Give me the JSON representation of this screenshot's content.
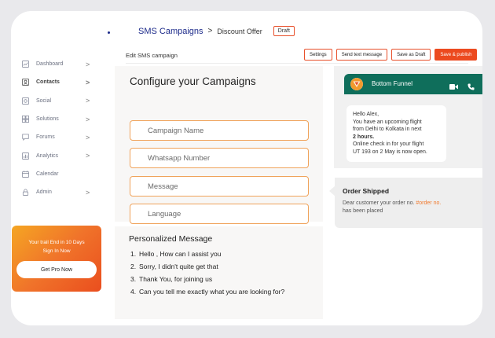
{
  "header": {
    "breadcrumb_main": "SMS Campaigns",
    "breadcrumb_sep": ">",
    "breadcrumb_sub": "Discount Offer",
    "status_badge": "Draft"
  },
  "toolbar": {
    "title": "Edit SMS campaign",
    "settings": "Settings",
    "send_test": "Send text message",
    "save_draft": "Save as Draft",
    "save_publish": "Save & publish"
  },
  "sidebar": {
    "items": [
      {
        "label": "Dashboard",
        "icon": "chart-icon"
      },
      {
        "label": "Contacts",
        "icon": "contacts-icon"
      },
      {
        "label": "Social",
        "icon": "social-icon"
      },
      {
        "label": "Solutions",
        "icon": "solutions-icon"
      },
      {
        "label": "Forums",
        "icon": "forums-icon"
      },
      {
        "label": "Analytics",
        "icon": "analytics-icon"
      },
      {
        "label": "Calendar",
        "icon": "calendar-icon"
      },
      {
        "label": "Admin",
        "icon": "lock-icon"
      }
    ],
    "chevron": ">"
  },
  "promo": {
    "line1": "Your trail End in 10 Days",
    "line2": "Sign In Now",
    "button": "Get Pro Now"
  },
  "config": {
    "title": "Configure your Campaigns",
    "fields": [
      "Campaign Name",
      "Whatsapp Number",
      "Message",
      "Language"
    ]
  },
  "personalized": {
    "title": "Personalized Message",
    "items": [
      {
        "num": "1.",
        "text": "Hello , How can I assist you"
      },
      {
        "num": "2.",
        "text": "Sorry, I didn't quite get that"
      },
      {
        "num": "3.",
        "text": "Thank You, for joining us"
      },
      {
        "num": "4.",
        "text": "Can you tell me exactly what you are looking for?"
      }
    ]
  },
  "chat": {
    "name": "Bottom Funnel",
    "lines": [
      "Hello Alex,",
      "You have an upcoming flight",
      "from Delhi to Kolkata in next",
      "2 hours.",
      "Online check in for your flight",
      "UT 193 on 2 May is now open."
    ]
  },
  "shipped": {
    "title": "Order Shipped",
    "body_pre": "Dear customer your order no.",
    "tag": "#order no.",
    "body_post": "has been placed"
  },
  "colors": {
    "accent": "#ec4a1f",
    "brand_blue": "#1c2a8a",
    "chat_header": "#0f6e5b",
    "field_border": "#f0a35b"
  }
}
